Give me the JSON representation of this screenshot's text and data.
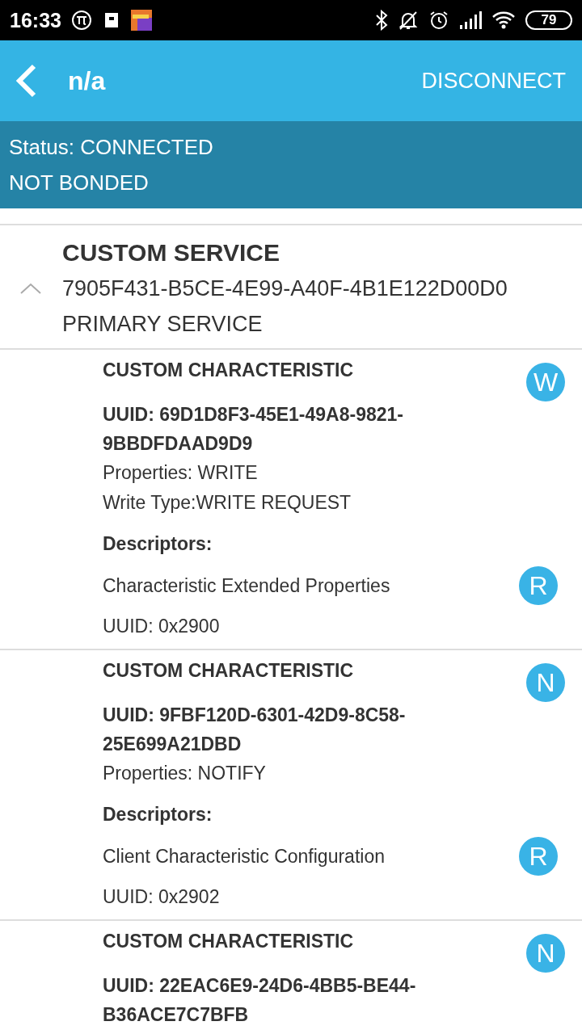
{
  "status_bar": {
    "time": "16:33",
    "battery": "79"
  },
  "header": {
    "title": "n/a",
    "action": "DISCONNECT"
  },
  "connection": {
    "status": "Status: CONNECTED",
    "bond": "NOT BONDED"
  },
  "service": {
    "name": "CUSTOM SERVICE",
    "uuid": "7905F431-B5CE-4E99-A40F-4B1E122D00D0",
    "type": "PRIMARY SERVICE",
    "expanded": true,
    "characteristics": [
      {
        "name": "CUSTOM CHARACTERISTIC",
        "badge": "W",
        "uuid": "UUID: 69D1D8F3-45E1-49A8-9821-9BBDFDAAD9D9",
        "properties": "Properties: WRITE",
        "write_type": "Write Type:WRITE REQUEST",
        "descriptors_label": "Descriptors:",
        "descriptors": [
          {
            "name": "Characteristic Extended Properties",
            "badge": "R",
            "uuid": "UUID: 0x2900"
          }
        ]
      },
      {
        "name": "CUSTOM CHARACTERISTIC",
        "badge": "N",
        "uuid": "UUID: 9FBF120D-6301-42D9-8C58-25E699A21DBD",
        "properties": "Properties: NOTIFY",
        "descriptors_label": "Descriptors:",
        "descriptors": [
          {
            "name": "Client Characteristic Configuration",
            "badge": "R",
            "uuid": "UUID: 0x2902"
          }
        ]
      },
      {
        "name": "CUSTOM CHARACTERISTIC",
        "badge": "N",
        "uuid": "UUID: 22EAC6E9-24D6-4BB5-BE44-B36ACE7C7BFB"
      }
    ]
  }
}
